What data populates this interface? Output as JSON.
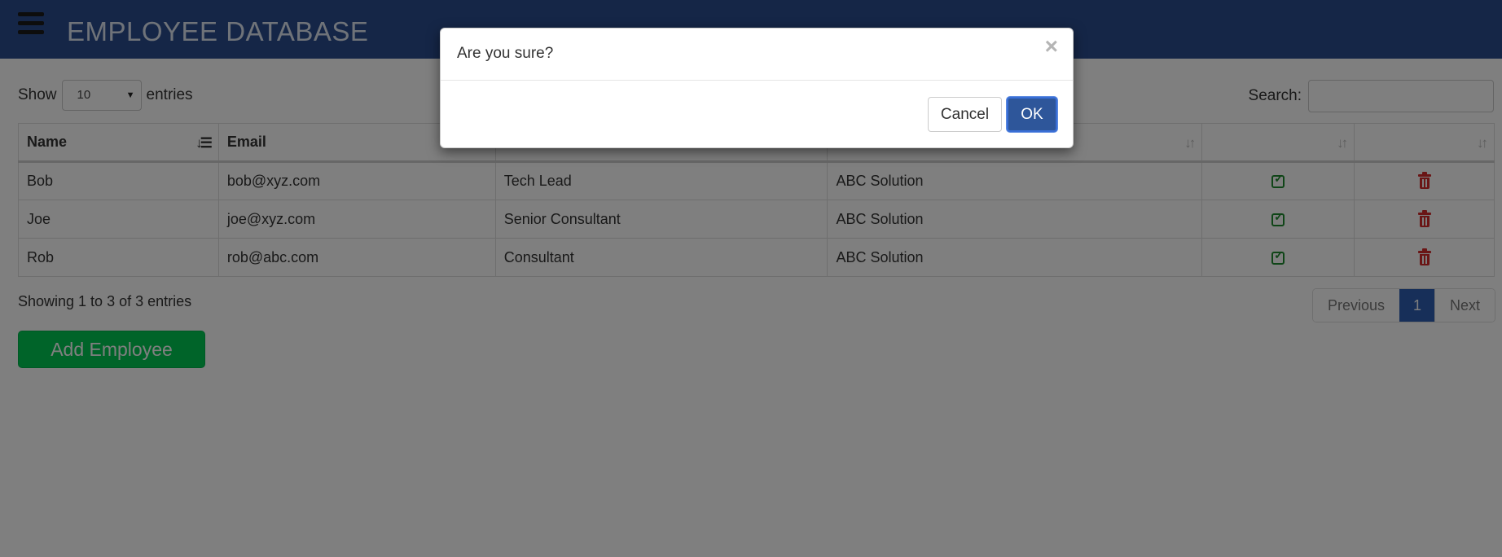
{
  "header": {
    "title": "EMPLOYEE DATABASE"
  },
  "length": {
    "show_label": "Show",
    "value": "10",
    "entries_label": "entries"
  },
  "search": {
    "label": "Search:",
    "value": ""
  },
  "table": {
    "columns": [
      {
        "label": "Name"
      },
      {
        "label": "Email"
      },
      {
        "label": ""
      },
      {
        "label": ""
      },
      {
        "label": ""
      },
      {
        "label": ""
      }
    ],
    "rows": [
      {
        "name": "Bob",
        "email": "bob@xyz.com",
        "designation": "Tech Lead",
        "company": "ABC Solution"
      },
      {
        "name": "Joe",
        "email": "joe@xyz.com",
        "designation": "Senior Consultant",
        "company": "ABC Solution"
      },
      {
        "name": "Rob",
        "email": "rob@abc.com",
        "designation": "Consultant",
        "company": "ABC Solution"
      }
    ]
  },
  "footer": {
    "info": "Showing 1 to 3 of 3 entries",
    "pagination": {
      "previous": "Previous",
      "current": "1",
      "next": "Next"
    },
    "add_button": "Add Employee"
  },
  "modal": {
    "title": "Are you sure?",
    "close": "×",
    "cancel_label": "Cancel",
    "ok_label": "OK"
  },
  "icons": {
    "menu": "hamburger-icon",
    "sort": "sort-icon",
    "edit": "edit-icon",
    "delete": "trash-icon",
    "close": "close-icon"
  },
  "colors": {
    "header_bg": "#2a4d8f",
    "primary": "#2f5eb3",
    "ok_button": "#2e569a",
    "add_button": "#00c853",
    "edit": "#1f8a2e",
    "delete": "#d42a2a"
  }
}
